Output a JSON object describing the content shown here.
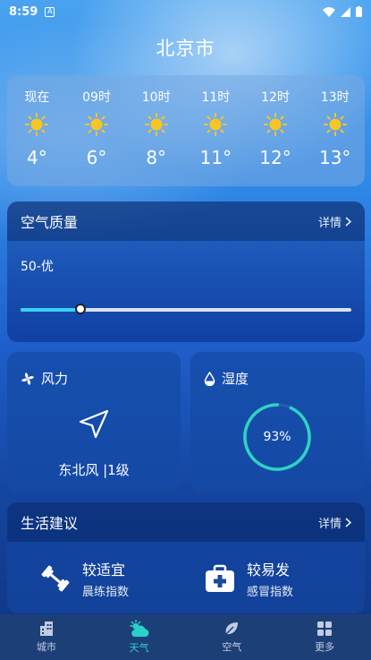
{
  "status": {
    "time": "8:59"
  },
  "city": "北京市",
  "hourly": [
    {
      "label": "现在",
      "temp": "4°"
    },
    {
      "label": "09时",
      "temp": "6°"
    },
    {
      "label": "10时",
      "temp": "8°"
    },
    {
      "label": "11时",
      "temp": "11°"
    },
    {
      "label": "12时",
      "temp": "12°"
    },
    {
      "label": "13时",
      "temp": "13°"
    }
  ],
  "air_quality": {
    "title": "空气质量",
    "more": "详情",
    "value": "50-优",
    "level_fraction": 0.18
  },
  "wind": {
    "title": "风力",
    "text": "东北风 |1级"
  },
  "humidity": {
    "title": "湿度",
    "value": "93%",
    "fraction": 0.93
  },
  "life": {
    "title": "生活建议",
    "more": "详情",
    "items": [
      {
        "title": "较适宜",
        "sub": "晨练指数",
        "icon": "dumbbell-icon"
      },
      {
        "title": "较易发",
        "sub": "感冒指数",
        "icon": "medkit-icon"
      }
    ]
  },
  "tabs": [
    {
      "label": "城市",
      "icon": "building-icon"
    },
    {
      "label": "天气",
      "icon": "weather-icon",
      "active": true
    },
    {
      "label": "空气",
      "icon": "leaf-icon"
    },
    {
      "label": "更多",
      "icon": "grid-icon"
    }
  ],
  "colors": {
    "accent": "#29d2c8",
    "sun": "#f7c624",
    "progress": "#3ad0f5"
  }
}
